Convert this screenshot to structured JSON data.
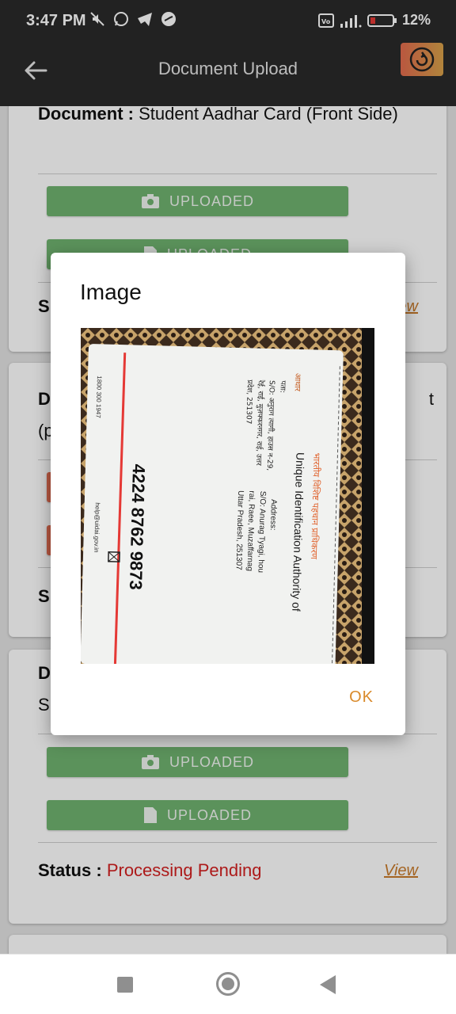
{
  "status_bar": {
    "time": "3:47 PM",
    "battery": "12%",
    "icons": [
      "mute-icon",
      "whatsapp-icon",
      "telegram-icon",
      "app-icon",
      "volte-icon",
      "signal-icon",
      "battery-icon"
    ]
  },
  "app_bar": {
    "title": "Document Upload",
    "back_icon": "arrow-left-icon",
    "refresh_icon": "refresh-icon"
  },
  "cards": [
    {
      "doc_label": "Document :",
      "doc_value": "Student Aadhar Card (Front Side)",
      "buttons": [
        {
          "icon": "camera-icon",
          "label": "UPLOADED"
        },
        {
          "icon": "file-icon",
          "label": "UPLOADED"
        }
      ],
      "status_label": "S",
      "view_label": "View"
    },
    {
      "doc_label": "D",
      "doc_value_partial_right": "t",
      "doc_line2": "(p",
      "status_label": "S"
    },
    {
      "doc_label": "D",
      "doc_line2": "S",
      "buttons": [
        {
          "icon": "camera-icon",
          "label": "UPLOADED"
        },
        {
          "icon": "file-icon",
          "label": "UPLOADED"
        }
      ],
      "status_label": "Status :",
      "status_value": "Processing Pending",
      "view_label": "View"
    }
  ],
  "dialog": {
    "title": "Image",
    "ok_label": "OK",
    "image": {
      "card_number": "4224 8762 9873",
      "header_hi": "भारतीय विशिष्ट पहचान प्राधिकरण",
      "header_en": "Unique Identification Authority of",
      "address_label": "Address:",
      "address_line1": "S/O: Anurag Tyagi, hou",
      "address_line2": "rai, Raee, Muzaffarnag",
      "address_line3": "Uttar Pradesh, 251307",
      "hindi_label": "पता:",
      "hindi_line1": "S/O: अनुराग त्यागी, हाउस न-29,",
      "hindi_line2": "रेई, राई, मुज़फ्फरनगर, राई, उत्तर",
      "hindi_line3": "प्रदेश, 251307",
      "helpline": "1800 300 1947",
      "email": "help@uidai.gov.in",
      "logo_word": "आधार"
    }
  },
  "colors": {
    "app_bar": "#2a2a2a",
    "button_green": "#6fb36f",
    "status_red": "#d32020",
    "link_orange": "#c87a2a",
    "ok_orange": "#d98a2b"
  }
}
